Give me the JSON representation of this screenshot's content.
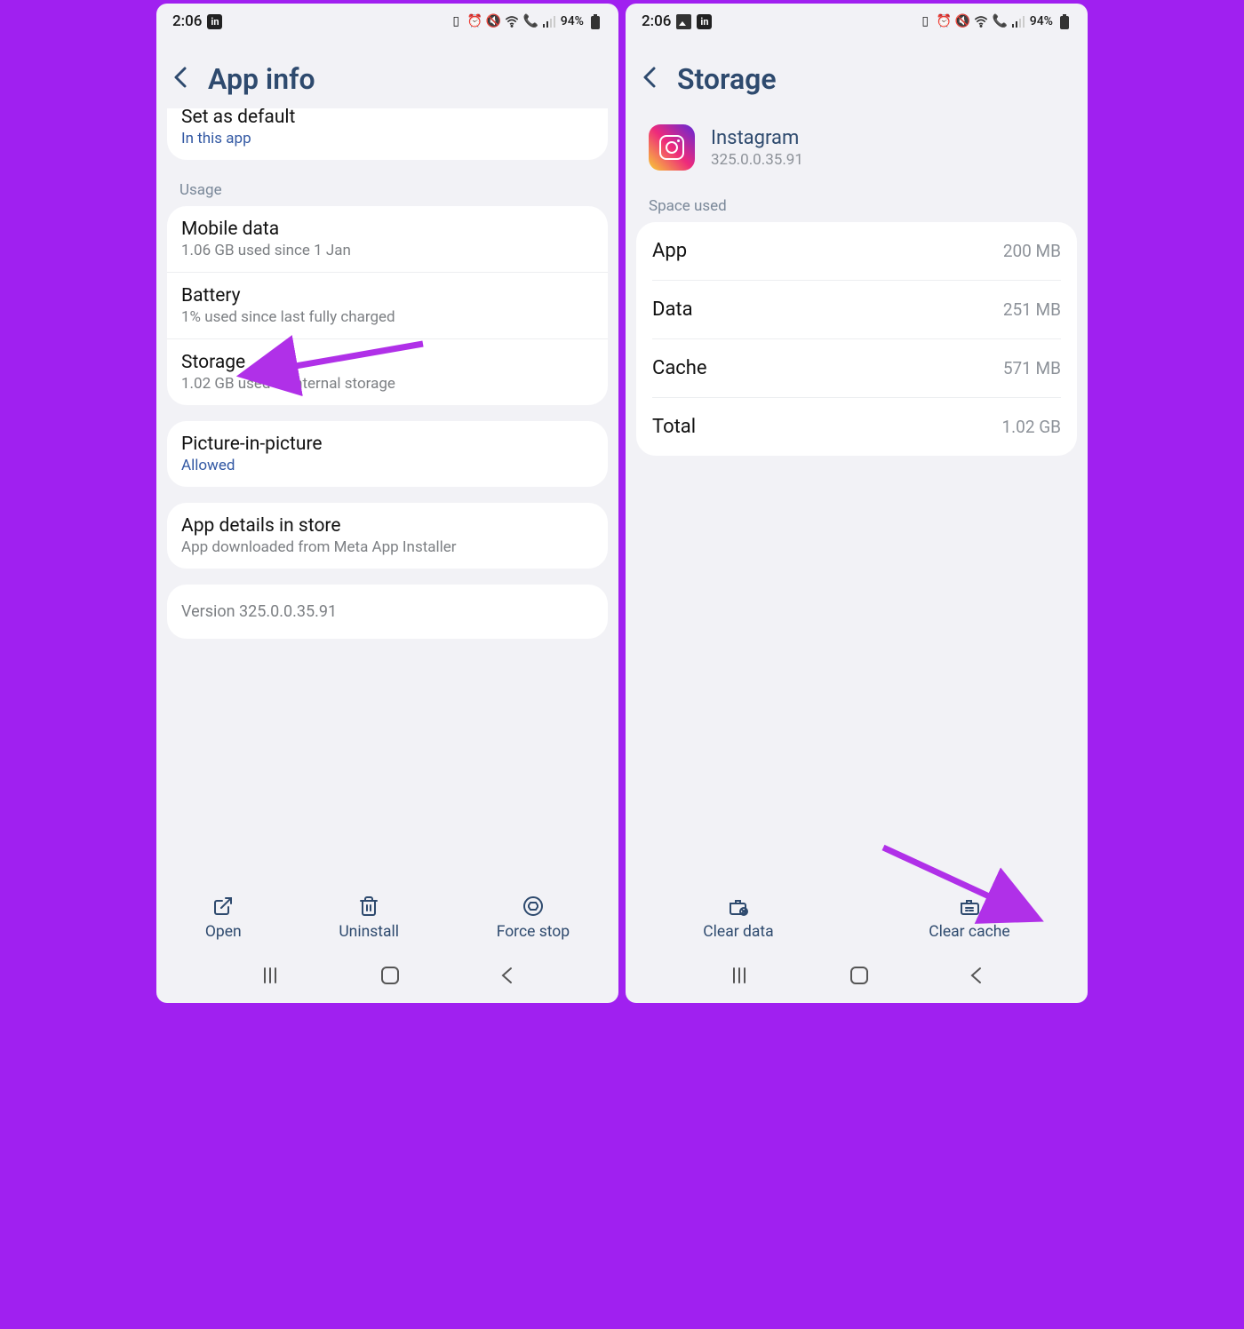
{
  "status": {
    "time": "2:06",
    "battery": "94%"
  },
  "left": {
    "title": "App info",
    "set_default_title": "Set as default",
    "set_default_sub": "In this app",
    "usage_label": "Usage",
    "mobile_title": "Mobile data",
    "mobile_sub": "1.06 GB used since 1 Jan",
    "battery_title": "Battery",
    "battery_sub": "1% used since last fully charged",
    "storage_title": "Storage",
    "storage_sub": "1.02 GB used in Internal storage",
    "pip_title": "Picture-in-picture",
    "pip_sub": "Allowed",
    "store_title": "App details in store",
    "store_sub": "App downloaded from Meta App Installer",
    "version": "Version 325.0.0.35.91",
    "actions": {
      "open": "Open",
      "uninstall": "Uninstall",
      "forcestop": "Force stop"
    }
  },
  "right": {
    "title": "Storage",
    "app_name": "Instagram",
    "app_version": "325.0.0.35.91",
    "space_used": "Space used",
    "rows": {
      "app_label": "App",
      "app_val": "200 MB",
      "data_label": "Data",
      "data_val": "251 MB",
      "cache_label": "Cache",
      "cache_val": "571 MB",
      "total_label": "Total",
      "total_val": "1.02 GB"
    },
    "actions": {
      "cleardata": "Clear data",
      "clearcache": "Clear cache"
    }
  }
}
